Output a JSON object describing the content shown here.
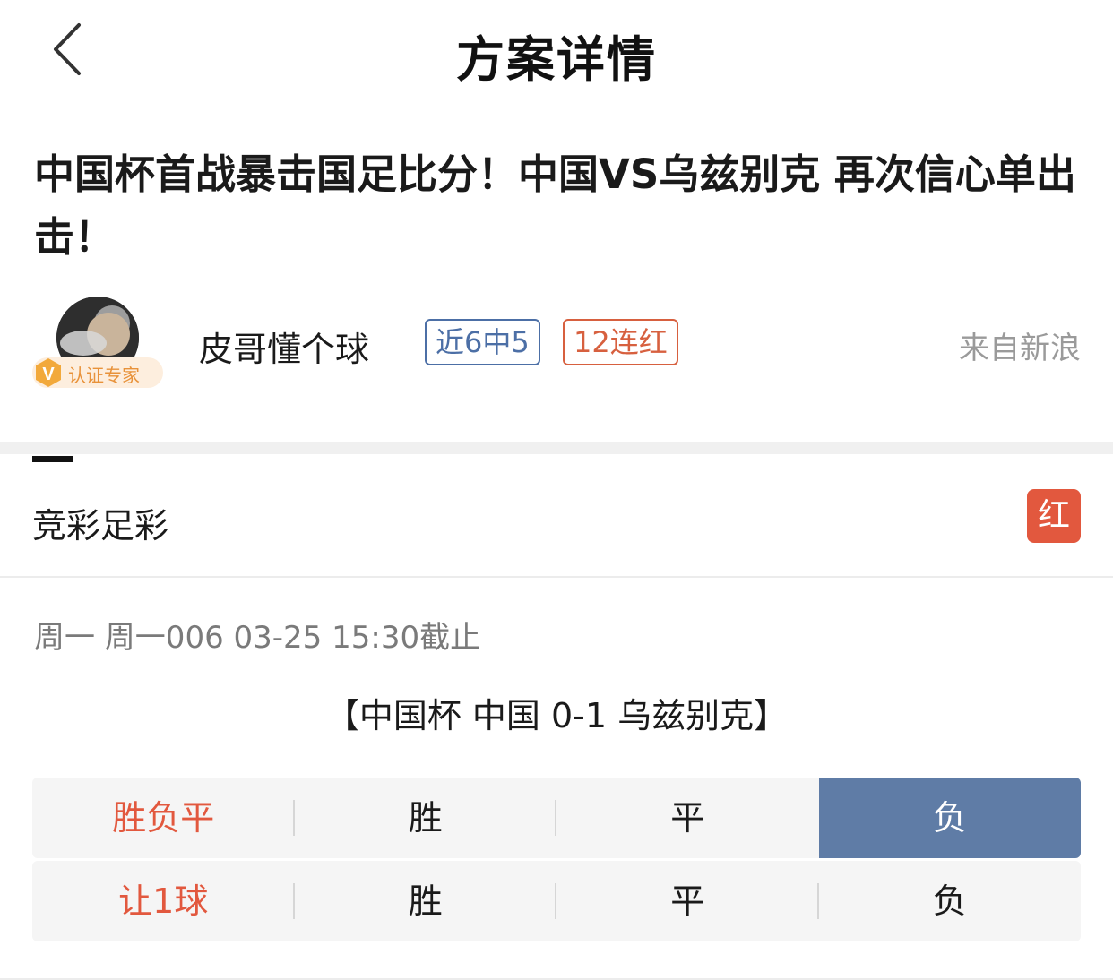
{
  "navbar": {
    "title": "方案详情",
    "back_icon": "chevron-left-icon"
  },
  "article": {
    "title": "中国杯首战暴击国足比分！中国VS乌兹别克 再次信心单出击！"
  },
  "author": {
    "name": "皮哥懂个球",
    "certification": "认证专家",
    "tags": [
      "近6中5",
      "12连红"
    ],
    "source": "来自新浪"
  },
  "section": {
    "title": "竞彩足彩",
    "result": "红"
  },
  "match": {
    "time": "周一 周一006 03-25 15:30截止",
    "title": "【中国杯 中国 0-1 乌兹别克】"
  },
  "bet_table": {
    "rows": [
      {
        "label": "胜负平",
        "options": [
          "胜",
          "平",
          "负"
        ],
        "selected": "负"
      },
      {
        "label": "让1球",
        "options": [
          "胜",
          "平",
          "负"
        ],
        "selected": ""
      }
    ]
  },
  "colors": {
    "accent_red": "#e2583e",
    "tag_blue": "#4c6fa6",
    "selected_blue": "#5f7ca6",
    "cert_orange": "#e8923a"
  }
}
